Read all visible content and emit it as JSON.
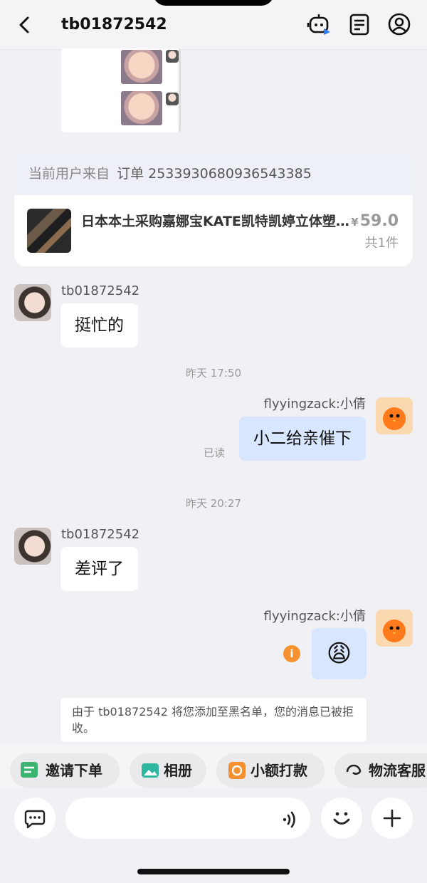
{
  "header": {
    "title": "tb01872542",
    "icons": [
      "back-icon",
      "robot-icon",
      "document-icon",
      "user-icon"
    ]
  },
  "order_card": {
    "label": "当前用户来自",
    "order_no": "订单 2533930680936543385",
    "product_title": "日本本土采购嘉娜宝KATE凯特凯婷立体塑型眉粉",
    "price_symbol": "¥",
    "price": "59.0",
    "quantity": "共1件"
  },
  "messages": [
    {
      "sender": "tb01872542",
      "text": "挺忙的"
    },
    {
      "timestamp": "昨天 17:50"
    },
    {
      "sender": "flyyingzack:小倩",
      "text": "小二给亲催下",
      "status": "已读"
    },
    {
      "timestamp": "昨天 20:27"
    },
    {
      "sender": "tb01872542",
      "text": "差评了"
    },
    {
      "sender": "flyyingzack:小倩",
      "emoji": "😩",
      "error_icon": "i"
    }
  ],
  "notice": "由于 tb01872542 将您添加至黑名单，您的消息已被拒收。",
  "quick_actions": [
    {
      "label": "邀请下单",
      "color": "#3cb371"
    },
    {
      "label": "相册",
      "color": "#2db6a0"
    },
    {
      "label": "小额打款",
      "color": "#f5922f"
    },
    {
      "label": "物流客服",
      "color": "#222222"
    }
  ],
  "input": {
    "placeholder": ""
  }
}
